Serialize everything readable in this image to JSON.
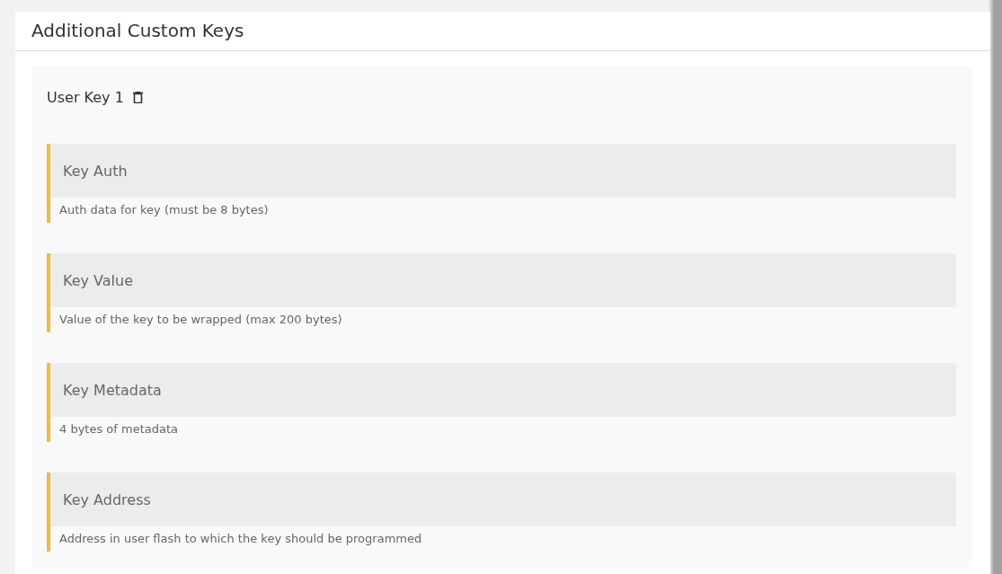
{
  "panel": {
    "title": "Additional Custom Keys"
  },
  "key": {
    "title": "User Key 1",
    "fields": [
      {
        "placeholder": "Key Auth",
        "hint": "Auth data for key (must be 8 bytes)"
      },
      {
        "placeholder": "Key Value",
        "hint": "Value of the key to be wrapped (max 200 bytes)"
      },
      {
        "placeholder": "Key Metadata",
        "hint": "4 bytes of metadata"
      },
      {
        "placeholder": "Key Address",
        "hint": "Address in user flash to which the key should be programmed"
      }
    ]
  }
}
